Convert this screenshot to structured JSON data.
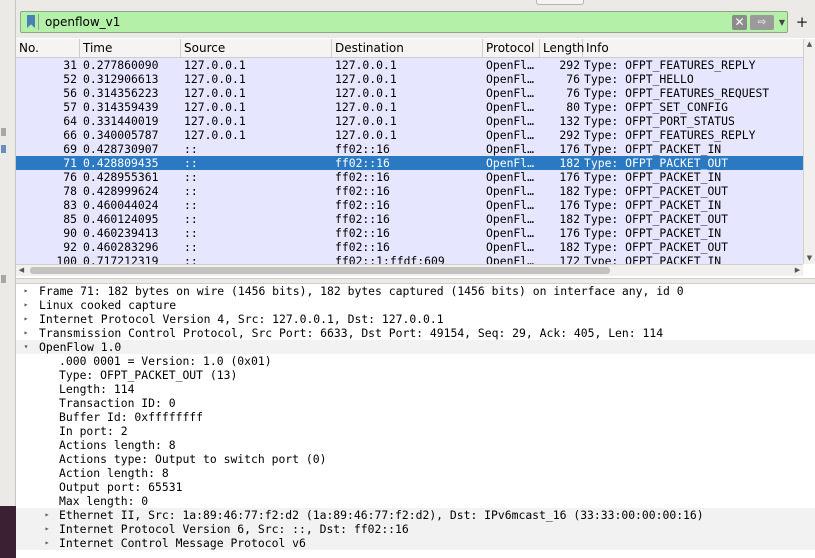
{
  "filter": {
    "value": "openflow_v1",
    "clear_icon": "✕",
    "apply_icon": "⇨"
  },
  "columns": [
    "No.",
    "Time",
    "Source",
    "Destination",
    "Protocol",
    "Length",
    "Info"
  ],
  "packets": [
    {
      "no": "31",
      "time": "0.277860090",
      "source": "127.0.0.1",
      "destination": "127.0.0.1",
      "protocol": "OpenFl…",
      "length": "292",
      "info": "Type: OFPT_FEATURES_REPLY",
      "selected": false
    },
    {
      "no": "52",
      "time": "0.312906613",
      "source": "127.0.0.1",
      "destination": "127.0.0.1",
      "protocol": "OpenFl…",
      "length": "76",
      "info": "Type: OFPT_HELLO",
      "selected": false
    },
    {
      "no": "56",
      "time": "0.314356223",
      "source": "127.0.0.1",
      "destination": "127.0.0.1",
      "protocol": "OpenFl…",
      "length": "76",
      "info": "Type: OFPT_FEATURES_REQUEST",
      "selected": false
    },
    {
      "no": "57",
      "time": "0.314359439",
      "source": "127.0.0.1",
      "destination": "127.0.0.1",
      "protocol": "OpenFl…",
      "length": "80",
      "info": "Type: OFPT_SET_CONFIG",
      "selected": false
    },
    {
      "no": "64",
      "time": "0.331440019",
      "source": "127.0.0.1",
      "destination": "127.0.0.1",
      "protocol": "OpenFl…",
      "length": "132",
      "info": "Type: OFPT_PORT_STATUS",
      "selected": false
    },
    {
      "no": "66",
      "time": "0.340005787",
      "source": "127.0.0.1",
      "destination": "127.0.0.1",
      "protocol": "OpenFl…",
      "length": "292",
      "info": "Type: OFPT_FEATURES_REPLY",
      "selected": false
    },
    {
      "no": "69",
      "time": "0.428730907",
      "source": "::",
      "destination": "ff02::16",
      "protocol": "OpenFl…",
      "length": "176",
      "info": "Type: OFPT_PACKET_IN",
      "selected": false
    },
    {
      "no": "71",
      "time": "0.428809435",
      "source": "::",
      "destination": "ff02::16",
      "protocol": "OpenFl…",
      "length": "182",
      "info": "Type: OFPT_PACKET_OUT",
      "selected": true
    },
    {
      "no": "76",
      "time": "0.428955361",
      "source": "::",
      "destination": "ff02::16",
      "protocol": "OpenFl…",
      "length": "176",
      "info": "Type: OFPT_PACKET_IN",
      "selected": false
    },
    {
      "no": "78",
      "time": "0.428999624",
      "source": "::",
      "destination": "ff02::16",
      "protocol": "OpenFl…",
      "length": "182",
      "info": "Type: OFPT_PACKET_OUT",
      "selected": false
    },
    {
      "no": "83",
      "time": "0.460044024",
      "source": "::",
      "destination": "ff02::16",
      "protocol": "OpenFl…",
      "length": "176",
      "info": "Type: OFPT_PACKET_IN",
      "selected": false
    },
    {
      "no": "85",
      "time": "0.460124095",
      "source": "::",
      "destination": "ff02::16",
      "protocol": "OpenFl…",
      "length": "182",
      "info": "Type: OFPT_PACKET_OUT",
      "selected": false
    },
    {
      "no": "90",
      "time": "0.460239413",
      "source": "::",
      "destination": "ff02::16",
      "protocol": "OpenFl…",
      "length": "176",
      "info": "Type: OFPT_PACKET_IN",
      "selected": false
    },
    {
      "no": "92",
      "time": "0.460283296",
      "source": "::",
      "destination": "ff02::16",
      "protocol": "OpenFl…",
      "length": "182",
      "info": "Type: OFPT_PACKET_OUT",
      "selected": false
    },
    {
      "no": "100",
      "time": "0.717212319",
      "source": "::",
      "destination": "ff02::1:ffdf:609",
      "protocol": "OpenFl…",
      "length": "172",
      "info": "Type: OFPT_PACKET_IN",
      "selected": false
    }
  ],
  "details": [
    {
      "text": "Frame 71: 182 bytes on wire (1456 bits), 182 bytes captured (1456 bits) on interface any, id 0",
      "level": 0,
      "arrow": "▸",
      "shade": false
    },
    {
      "text": "Linux cooked capture",
      "level": 0,
      "arrow": "▸",
      "shade": false
    },
    {
      "text": "Internet Protocol Version 4, Src: 127.0.0.1, Dst: 127.0.0.1",
      "level": 0,
      "arrow": "▸",
      "shade": false
    },
    {
      "text": "Transmission Control Protocol, Src Port: 6633, Dst Port: 49154, Seq: 29, Ack: 405, Len: 114",
      "level": 0,
      "arrow": "▸",
      "shade": false
    },
    {
      "text": "OpenFlow 1.0",
      "level": 0,
      "arrow": "▾",
      "shade": true
    },
    {
      "text": ".000 0001 = Version: 1.0 (0x01)",
      "level": 1,
      "arrow": "",
      "shade": false
    },
    {
      "text": "Type: OFPT_PACKET_OUT (13)",
      "level": 1,
      "arrow": "",
      "shade": false
    },
    {
      "text": "Length: 114",
      "level": 1,
      "arrow": "",
      "shade": false
    },
    {
      "text": "Transaction ID: 0",
      "level": 1,
      "arrow": "",
      "shade": false
    },
    {
      "text": "Buffer Id: 0xffffffff",
      "level": 1,
      "arrow": "",
      "shade": false
    },
    {
      "text": "In port: 2",
      "level": 1,
      "arrow": "",
      "shade": false
    },
    {
      "text": "Actions length: 8",
      "level": 1,
      "arrow": "",
      "shade": false
    },
    {
      "text": "Actions type: Output to switch port (0)",
      "level": 1,
      "arrow": "",
      "shade": false
    },
    {
      "text": "Action length: 8",
      "level": 1,
      "arrow": "",
      "shade": false
    },
    {
      "text": "Output port: 65531",
      "level": 1,
      "arrow": "",
      "shade": false
    },
    {
      "text": "Max length: 0",
      "level": 1,
      "arrow": "",
      "shade": false
    },
    {
      "text": "Ethernet II, Src: 1a:89:46:77:f2:d2 (1a:89:46:77:f2:d2), Dst: IPv6mcast_16 (33:33:00:00:00:16)",
      "level": 1,
      "arrow": "▸",
      "shade": true
    },
    {
      "text": "Internet Protocol Version 6, Src: ::, Dst: ff02::16",
      "level": 1,
      "arrow": "▸",
      "shade": true
    },
    {
      "text": "Internet Control Message Protocol v6",
      "level": 1,
      "arrow": "▸",
      "shade": true
    }
  ],
  "colors": {
    "filter_valid_bg": "#b4f0a8",
    "row_openflow_bg": "#e7e6ff",
    "row_selected_bg": "#2a79c2"
  }
}
